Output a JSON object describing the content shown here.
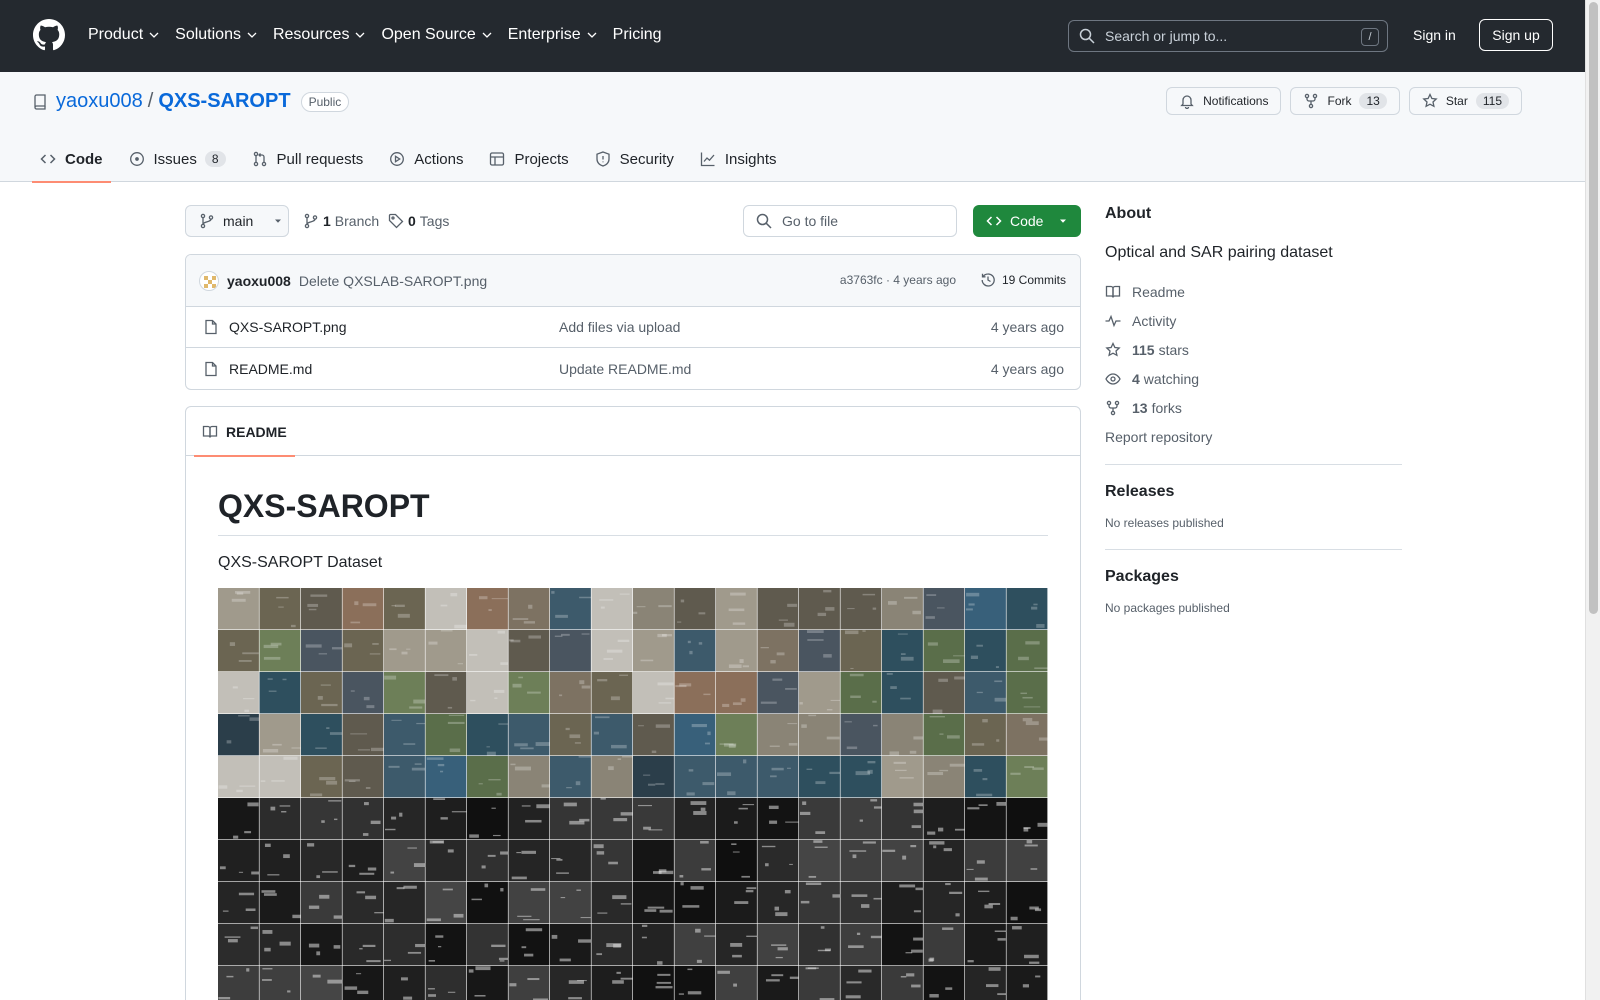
{
  "header": {
    "nav": [
      "Product",
      "Solutions",
      "Resources",
      "Open Source",
      "Enterprise",
      "Pricing"
    ],
    "search_placeholder": "Search or jump to...",
    "search_shortcut": "/",
    "signin": "Sign in",
    "signup": "Sign up"
  },
  "repo": {
    "owner": "yaoxu008",
    "separator": "/",
    "name": "QXS-SAROPT",
    "visibility": "Public",
    "notifications": "Notifications",
    "fork_label": "Fork",
    "fork_count": "13",
    "star_label": "Star",
    "star_count": "115"
  },
  "tabs": [
    {
      "label": "Code",
      "icon": "code-icon",
      "active": true
    },
    {
      "label": "Issues",
      "icon": "issue-icon",
      "count": "8"
    },
    {
      "label": "Pull requests",
      "icon": "pull-request-icon"
    },
    {
      "label": "Actions",
      "icon": "play-icon"
    },
    {
      "label": "Projects",
      "icon": "table-icon"
    },
    {
      "label": "Security",
      "icon": "shield-icon"
    },
    {
      "label": "Insights",
      "icon": "graph-icon"
    }
  ],
  "toolbar": {
    "branch": "main",
    "branch_count": "1",
    "branch_label": "Branch",
    "tag_count": "0",
    "tag_label": "Tags",
    "goto_placeholder": "Go to file",
    "code_button": "Code"
  },
  "commit": {
    "author": "yaoxu008",
    "message": "Delete QXSLAB-SAROPT.png",
    "meta": "a3763fc · 4 years ago",
    "commits": "19 Commits"
  },
  "files": [
    {
      "name": "QXS-SAROPT.png",
      "message": "Add files via upload",
      "time": "4 years ago"
    },
    {
      "name": "README.md",
      "message": "Update README.md",
      "time": "4 years ago"
    }
  ],
  "readme": {
    "tab": "README",
    "title": "QXS-SAROPT",
    "text": "QXS-SAROPT Dataset"
  },
  "sidebar": {
    "about_title": "About",
    "description": "Optical and SAR pairing dataset",
    "readme": "Readme",
    "activity": "Activity",
    "stars_count": "115",
    "stars_label": "stars",
    "watching_count": "4",
    "watching_label": "watching",
    "forks_count": "13",
    "forks_label": "forks",
    "report": "Report repository",
    "releases_title": "Releases",
    "releases_note": "No releases published",
    "packages_title": "Packages",
    "packages_note": "No packages published"
  },
  "colors": {
    "header_bg": "#24292f",
    "link": "#0969da",
    "primary_button": "#1f883d",
    "active_tab_underline": "#fd8c73"
  }
}
